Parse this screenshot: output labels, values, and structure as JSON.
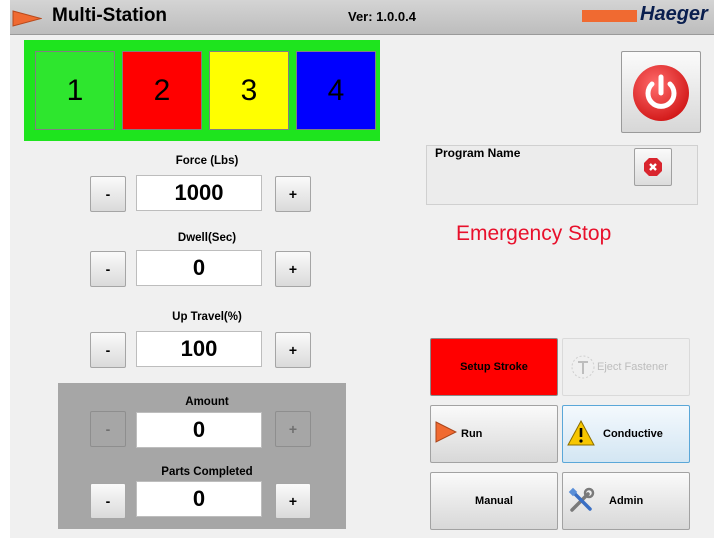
{
  "header": {
    "title": "Multi-Station",
    "version": "Ver: 1.0.0.4",
    "brand": "Haeger"
  },
  "stations": [
    {
      "label": "1",
      "color": "#2ee62e"
    },
    {
      "label": "2",
      "color": "#ff0000"
    },
    {
      "label": "3",
      "color": "#ffff00"
    },
    {
      "label": "4",
      "color": "#0000ff"
    }
  ],
  "stations_frame_color": "#1ee41e",
  "program": {
    "label": "Program Name",
    "value": ""
  },
  "status": {
    "message": "Emergency Stop",
    "color": "#e8102b"
  },
  "params": {
    "force": {
      "label": "Force (Lbs)",
      "value": "1000",
      "minus": "-",
      "plus": "+"
    },
    "dwell": {
      "label": "Dwell(Sec)",
      "value": "0",
      "minus": "-",
      "plus": "+"
    },
    "uptravel": {
      "label": "Up Travel(%)",
      "value": "100",
      "minus": "-",
      "plus": "+"
    },
    "amount": {
      "label": "Amount",
      "value": "0",
      "minus": "-",
      "plus": "+"
    },
    "parts": {
      "label": "Parts Completed",
      "value": "0",
      "minus": "-",
      "plus": "+"
    }
  },
  "actions": {
    "setup_stroke": "Setup Stroke",
    "eject_fastener": "Eject Fastener",
    "run": "Run",
    "conductive": "Conductive",
    "manual": "Manual",
    "admin": "Admin"
  },
  "icons": {
    "logo": "play-triangle-icon",
    "power": "power-icon",
    "clear": "clear-icon",
    "eject": "eject-icon",
    "run": "run-icon",
    "warning": "warning-icon",
    "admin": "tools-icon"
  }
}
